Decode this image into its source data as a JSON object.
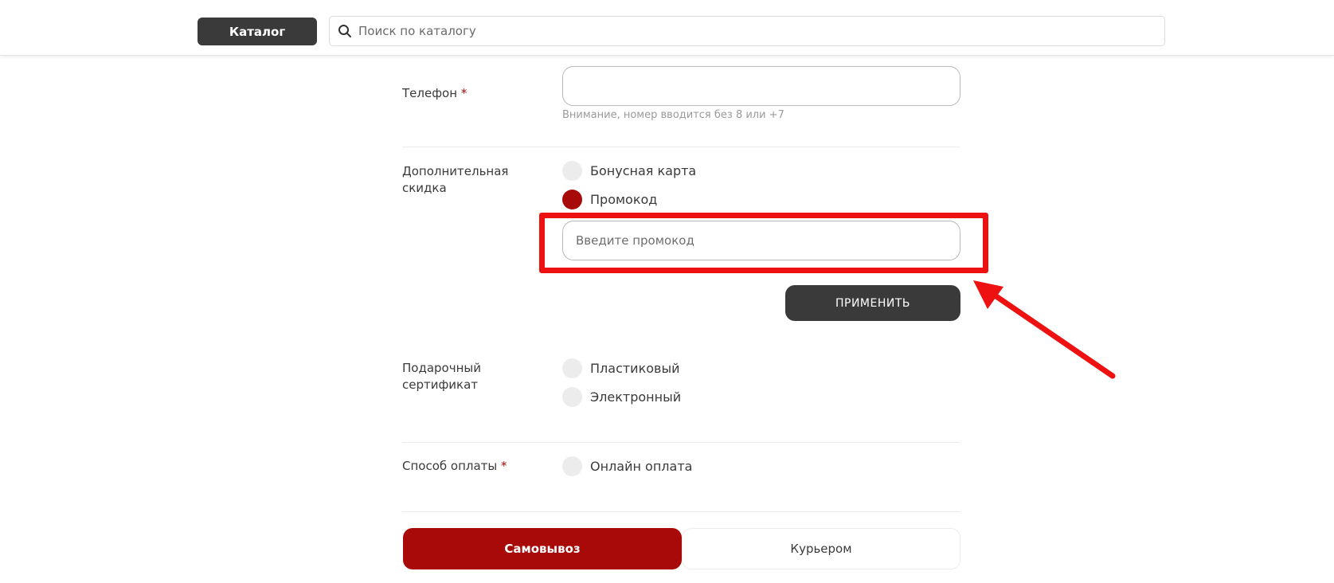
{
  "header": {
    "catalog_label": "Каталог",
    "search_placeholder": "Поиск по каталогу"
  },
  "form": {
    "phone": {
      "label": "Телефон",
      "required_mark": "*",
      "value": "",
      "hint": "Внимание, номер вводится без 8 или +7"
    },
    "discount": {
      "label_line1": "Дополнительная",
      "label_line2": "скидка",
      "options": [
        {
          "label": "Бонусная карта",
          "checked": false
        },
        {
          "label": "Промокод",
          "checked": true
        }
      ],
      "promo_placeholder": "Введите промокод",
      "apply_label": "ПРИМЕНИТЬ"
    },
    "gift_certificate": {
      "label_line1": "Подарочный",
      "label_line2": "сертификат",
      "options": [
        {
          "label": "Пластиковый",
          "checked": false
        },
        {
          "label": "Электронный",
          "checked": false
        }
      ]
    },
    "payment": {
      "label": "Способ оплаты",
      "required_mark": "*",
      "options": [
        {
          "label": "Онлайн оплата",
          "checked": false
        }
      ]
    },
    "delivery": {
      "pickup_label": "Самовывоз",
      "courier_label": "Курьером",
      "selected": "pickup"
    }
  },
  "colors": {
    "accent": "#a80a0a",
    "dark_button": "#3a3a3a",
    "annotation_red": "#ee1111"
  }
}
